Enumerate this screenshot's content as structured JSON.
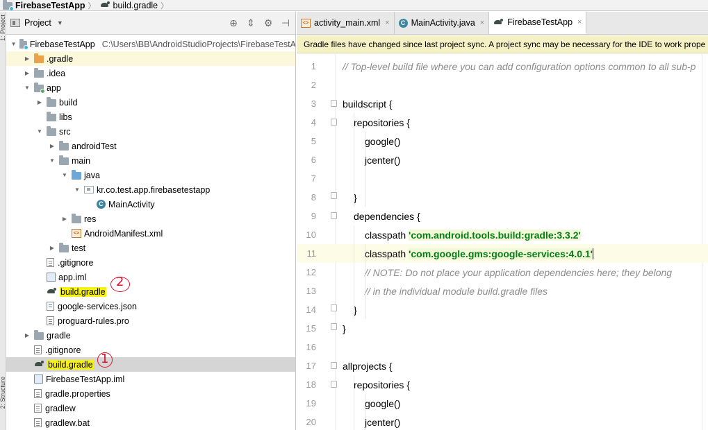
{
  "breadcrumb": {
    "project": "FirebaseTestApp",
    "file": "build.gradle"
  },
  "tool_strip": {
    "project_tab": "1: Project",
    "structure_tab": "2: Structure"
  },
  "project_panel": {
    "view_label": "Project",
    "header_icons": [
      "globe-icon",
      "collapse-icon",
      "settings-icon",
      "hide-icon"
    ],
    "tree": [
      {
        "label": "FirebaseTestApp",
        "extra": "C:\\Users\\BB\\AndroidStudioProjects\\FirebaseTestA",
        "expanded": true,
        "icon": "module-root-folder-icon"
      },
      {
        "label": ".gradle",
        "expanded": false,
        "icon": "folder-icon-orange"
      },
      {
        "label": ".idea",
        "expanded": false,
        "icon": "folder-icon"
      },
      {
        "label": "app",
        "expanded": true,
        "icon": "module-folder-icon"
      },
      {
        "label": "build",
        "expanded": false,
        "icon": "folder-icon"
      },
      {
        "label": "libs",
        "icon": "folder-icon"
      },
      {
        "label": "src",
        "expanded": true,
        "icon": "folder-icon"
      },
      {
        "label": "androidTest",
        "expanded": false,
        "icon": "folder-icon"
      },
      {
        "label": "main",
        "expanded": true,
        "icon": "folder-icon"
      },
      {
        "label": "java",
        "expanded": true,
        "icon": "source-folder-icon"
      },
      {
        "label": "kr.co.test.app.firebasetestapp",
        "expanded": true,
        "icon": "package-icon"
      },
      {
        "label": "MainActivity",
        "icon": "class-icon"
      },
      {
        "label": "res",
        "expanded": false,
        "icon": "resource-folder-icon"
      },
      {
        "label": "AndroidManifest.xml",
        "icon": "xml-icon"
      },
      {
        "label": "test",
        "expanded": false,
        "icon": "folder-icon"
      },
      {
        "label": ".gitignore",
        "icon": "file-icon"
      },
      {
        "label": "app.iml",
        "icon": "iml-icon"
      },
      {
        "label": "build.gradle",
        "icon": "gradle-icon",
        "highlighted": true
      },
      {
        "label": "google-services.json",
        "icon": "json-icon"
      },
      {
        "label": "proguard-rules.pro",
        "icon": "file-icon"
      },
      {
        "label": "gradle",
        "expanded": false,
        "icon": "folder-icon"
      },
      {
        "label": ".gitignore",
        "icon": "file-icon"
      },
      {
        "label": "build.gradle",
        "icon": "gradle-icon",
        "highlighted": true,
        "selected": true
      },
      {
        "label": "FirebaseTestApp.iml",
        "icon": "iml-icon"
      },
      {
        "label": "gradle.properties",
        "icon": "file-icon"
      },
      {
        "label": "gradlew",
        "icon": "file-icon"
      },
      {
        "label": "gradlew.bat",
        "icon": "file-icon"
      }
    ],
    "annotations": {
      "first": "1",
      "second": "2"
    }
  },
  "editor": {
    "tabs": [
      {
        "label": "activity_main.xml",
        "icon": "xml-icon",
        "active": false
      },
      {
        "label": "MainActivity.java",
        "icon": "class-icon",
        "active": false
      },
      {
        "label": "FirebaseTestApp",
        "icon": "gradle-icon",
        "active": true
      }
    ],
    "close_glyph": "×",
    "sync_banner": "Gradle files have changed since last project sync. A project sync may be necessary for the IDE to work prope",
    "current_line": 11,
    "lines": [
      {
        "n": "1",
        "text": "// Top-level build file where you can add configuration options common to all sub-p",
        "kind": "comment",
        "indent": 0
      },
      {
        "n": "2",
        "text": "",
        "indent": 0
      },
      {
        "n": "3",
        "text": "buildscript {",
        "indent": 0,
        "fold": "start"
      },
      {
        "n": "4",
        "text": "repositories {",
        "indent": 1,
        "fold": "start"
      },
      {
        "n": "5",
        "text": "google()",
        "indent": 2
      },
      {
        "n": "6",
        "text": "jcenter()",
        "indent": 2
      },
      {
        "n": "7",
        "text": "",
        "indent": 0
      },
      {
        "n": "8",
        "text": "}",
        "indent": 1,
        "fold": "end"
      },
      {
        "n": "9",
        "text": "dependencies {",
        "indent": 1,
        "fold": "start"
      },
      {
        "n": "10",
        "text": "classpath ",
        "str": "'com.android.tools.build:gradle:3.3.2'",
        "indent": 2
      },
      {
        "n": "11",
        "text": "classpath ",
        "str": "'com.google.gms:google-services:4.0.1'",
        "indent": 2,
        "caret": true
      },
      {
        "n": "12",
        "text": "// NOTE: Do not place your application dependencies here; they belong",
        "kind": "comment",
        "indent": 2
      },
      {
        "n": "13",
        "text": "// in the individual module build.gradle files",
        "kind": "comment",
        "indent": 2
      },
      {
        "n": "14",
        "text": "}",
        "indent": 1,
        "fold": "end"
      },
      {
        "n": "15",
        "text": "}",
        "indent": 0,
        "fold": "end"
      },
      {
        "n": "16",
        "text": "",
        "indent": 0
      },
      {
        "n": "17",
        "text": "allprojects {",
        "indent": 0,
        "fold": "start"
      },
      {
        "n": "18",
        "text": "repositories {",
        "indent": 1,
        "fold": "start"
      },
      {
        "n": "19",
        "text": "google()",
        "indent": 2
      },
      {
        "n": "20",
        "text": "jcenter()",
        "indent": 2
      }
    ]
  }
}
